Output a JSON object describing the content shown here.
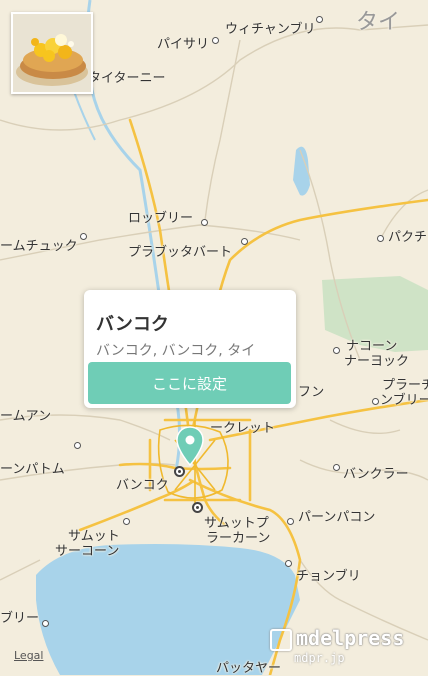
{
  "map": {
    "labels": {
      "taiwater": "タイ",
      "wichanburi": "ウィチャンブリ",
      "paisari": "パイサリ",
      "taitani": "タイターニー",
      "loburi": "ロッブリー",
      "parabatbat": "プラブッタバート",
      "pakuchi": "パクチ",
      "chuck": "ームチュック",
      "nakon": "ナコーン",
      "nayok": "ナーヨック",
      "prachin1": "プラーチ",
      "prachin2": "ンブリー",
      "fun": "フン",
      "mamuan": "ームアン",
      "secret": "ークレット",
      "pathum": "ーンパトム",
      "bangkok": "バンコク",
      "bangkra": "バンクラー",
      "samut1": "サムット",
      "samut2": "サーコーン",
      "samutp1": "サムットプ",
      "samutp2": "ラーカーン",
      "panpakon": "パーンパコン",
      "chonburi": "チョンブリ",
      "buri": "ブリー",
      "pataya": "パッタヤー"
    }
  },
  "thumbnail": {
    "alt": "pancake-photo"
  },
  "popup": {
    "title": "バンコク",
    "subtitle": "バンコク, バンコク, タイ",
    "button_label": "ここに設定"
  },
  "legal": "Legal",
  "watermark": {
    "main": "mdelpress",
    "sub": "mdpr.jp"
  },
  "colors": {
    "button": "#6fcdb6",
    "water": "#a8d3ea",
    "road": "#f5c242",
    "park": "#cfe3c6"
  }
}
